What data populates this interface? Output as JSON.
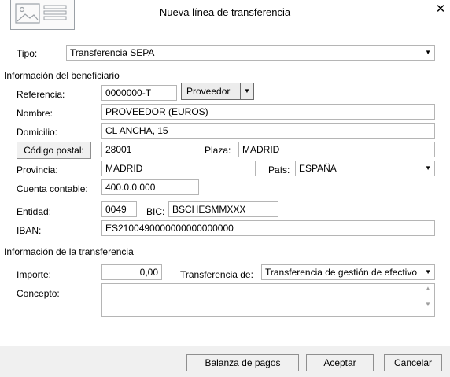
{
  "window": {
    "title": "Nueva línea de transferencia",
    "close_icon": "✕"
  },
  "tipo": {
    "label": "Tipo:",
    "value": "Transferencia SEPA"
  },
  "beneficiario": {
    "section_title": "Información del beneficiario",
    "referencia_label": "Referencia:",
    "referencia_value": "0000000-T",
    "tipo_button": "Proveedor",
    "nombre_label": "Nombre:",
    "nombre_value": "PROVEEDOR (EUROS)",
    "domicilio_label": "Domicilio:",
    "domicilio_value": "CL ANCHA, 15",
    "codigo_postal_button": "Código postal:",
    "codigo_postal_value": "28001",
    "plaza_label": "Plaza:",
    "plaza_value": "MADRID",
    "provincia_label": "Provincia:",
    "provincia_value": "MADRID",
    "pais_label": "País:",
    "pais_value": "ESPAÑA",
    "cuenta_label": "Cuenta contable:",
    "cuenta_value": "400.0.0.000",
    "entidad_label": "Entidad:",
    "entidad_value": "0049",
    "bic_label": "BIC:",
    "bic_value": "BSCHESMMXXX",
    "iban_label": "IBAN:",
    "iban_value": "ES2100490000000000000000"
  },
  "transferencia": {
    "section_title": "Información de la transferencia",
    "importe_label": "Importe:",
    "importe_value": "0,00",
    "transferencia_de_label": "Transferencia de:",
    "transferencia_de_value": "Transferencia de gestión de efectivo",
    "concepto_label": "Concepto:",
    "concepto_value": ""
  },
  "footer": {
    "balanza_button": "Balanza de pagos",
    "aceptar_button": "Aceptar",
    "cancelar_button": "Cancelar"
  }
}
